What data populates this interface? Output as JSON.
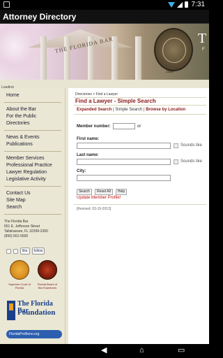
{
  "status": {
    "time": "7:31"
  },
  "app": {
    "title": "Attorney Directory"
  },
  "banner": {
    "building_text": "THE FLORIDA BAR",
    "seal_year": "1950",
    "side_text": "T",
    "side_sub": "F"
  },
  "loading_text": "Loading",
  "sidebar": {
    "group1": [
      "Home"
    ],
    "group2": [
      "About the Bar",
      "For the Public",
      "Directories"
    ],
    "group3": [
      "News & Events",
      "Publications"
    ],
    "group4": [
      "Member Services",
      "Professional Practice",
      "Lawyer Regulation",
      "Legislative Activity"
    ],
    "group5": [
      "Contact Us",
      "Site Map",
      "Search"
    ],
    "address": [
      "The Florida Bar",
      "651 E. Jefferson Street",
      "Tallahassee, FL 32399-2300",
      "(850) 561-5600"
    ],
    "social": {
      "like": "like",
      "follow": "follow"
    },
    "logo_left_caption": "Supreme Court of Florida",
    "logo_right_caption": "Florida Board of Bar Examiners",
    "foundation": {
      "line1": "The Florida Bar",
      "line2": "Foundation"
    },
    "probono": "FloridaProBono.org"
  },
  "main": {
    "breadcrumb": "Directories  >  Find a Lawyer",
    "heading": "Find a Lawyer - Simple Search",
    "links": {
      "expanded": "Expanded Search",
      "sep1": " | ",
      "simple": "Simple Search",
      "sep2": " | ",
      "browse": "Browse by Location"
    },
    "member_label": "Member number:",
    "or_text": "or",
    "first_label": "First name:",
    "last_label": "Last name:",
    "city_label": "City:",
    "sounds_like": "Sounds like",
    "buttons": {
      "search": "Search",
      "reset": "Reset All",
      "help": "Help"
    },
    "update_link": "Update Member Profile!",
    "revised": "[Revised: 03-19-2013]"
  },
  "colors": {
    "accent": "#8b1a1a",
    "sidebar_bg": "#eae7d4",
    "brand_blue": "#1a3f8a"
  }
}
